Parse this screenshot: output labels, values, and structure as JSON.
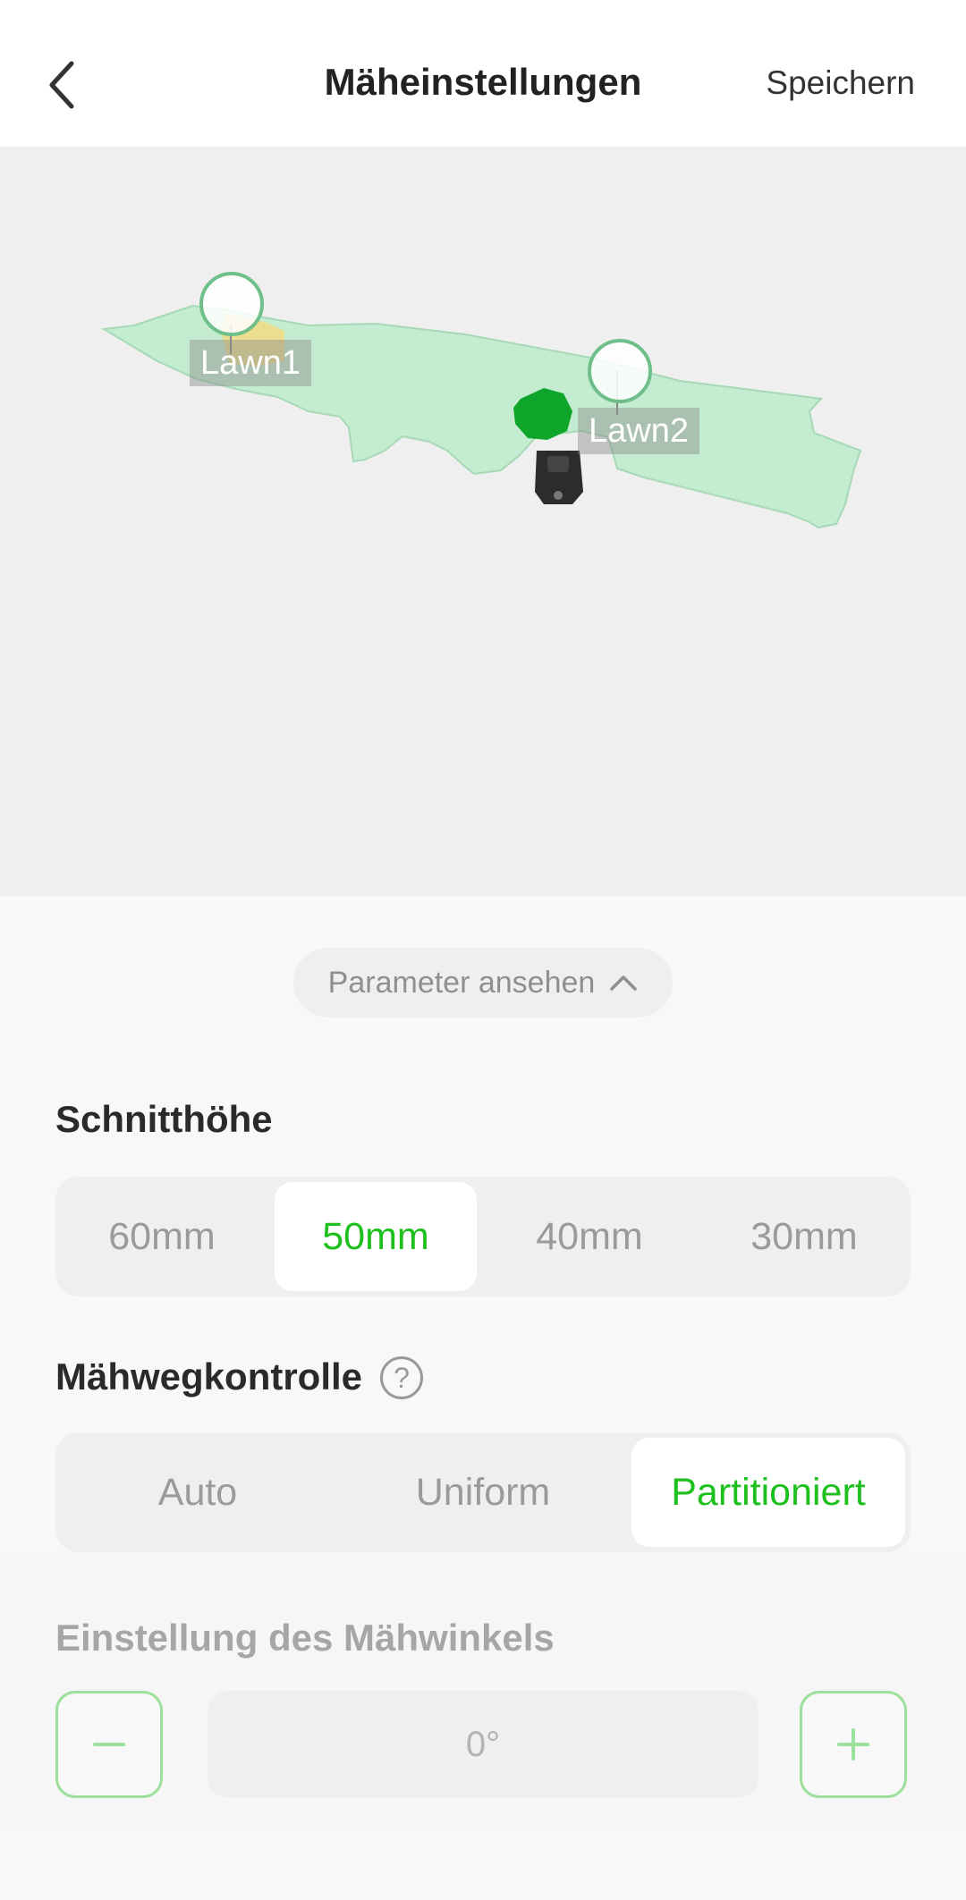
{
  "header": {
    "title": "Mäheinstellungen",
    "save_label": "Speichern"
  },
  "map": {
    "zones": [
      {
        "label": "Lawn1"
      },
      {
        "label": "Lawn2"
      }
    ],
    "colors": {
      "lawn_fill": "#c3ecd0",
      "obstacle": "#0fa52a",
      "marker_ring": "#6fbf8a"
    }
  },
  "panel": {
    "param_pill_label": "Parameter ansehen",
    "cut_height": {
      "title": "Schnitthöhe",
      "options": [
        "60mm",
        "50mm",
        "40mm",
        "30mm"
      ],
      "selected": "50mm"
    },
    "path_control": {
      "title": "Mähwegkontrolle",
      "help_symbol": "?",
      "options": [
        "Auto",
        "Uniform",
        "Partitioniert"
      ],
      "selected": "Partitioniert"
    },
    "angle": {
      "title": "Einstellung des Mähwinkels",
      "value": "0°",
      "minus_icon": "minus-icon",
      "plus_icon": "plus-icon"
    },
    "accent_color": "#1ec01e"
  }
}
